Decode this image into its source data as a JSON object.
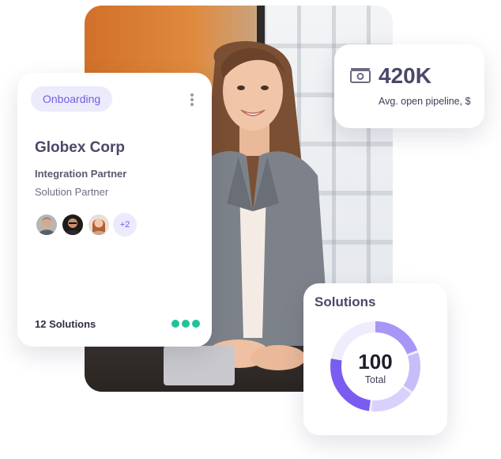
{
  "company_card": {
    "status_badge": "Onboarding",
    "company_name": "Globex Corp",
    "partner_type": "Integration Partner",
    "partner_subtype": "Solution Partner",
    "extra_members": "+2",
    "solutions_count": "12 Solutions"
  },
  "pipeline_card": {
    "value": "420K",
    "label": "Avg. open pipeline, $",
    "icon": "cash-icon"
  },
  "solutions_card": {
    "title": "Solutions",
    "total_value": "100",
    "total_label": "Total"
  },
  "colors": {
    "accent": "#7b5cf0",
    "accent_light": "#ecebfc",
    "status_green": "#1ec39a",
    "text_dark": "#4a4868"
  }
}
